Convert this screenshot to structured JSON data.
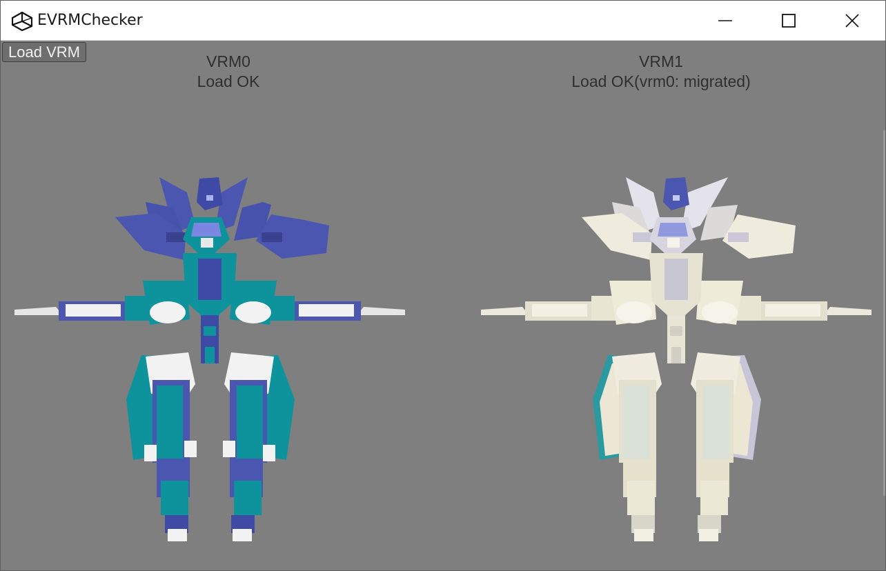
{
  "window": {
    "title": "EVRMChecker",
    "icon": "unity-logo-icon",
    "controls": [
      "minimize-icon",
      "maximize-icon",
      "close-icon"
    ]
  },
  "toolbar": {
    "load_button_label": "Load VRM"
  },
  "panels": [
    {
      "title": "VRM0",
      "status": "Load OK"
    },
    {
      "title": "VRM1",
      "status": "Load OK(vrm0: migrated)"
    }
  ],
  "colors": {
    "viewport_background": "#7f7f7f",
    "vrm0_primary": "#4a56b0",
    "vrm0_secondary": "#0e929c",
    "vrm0_trim": "#f2f2f2",
    "vrm1_primary": "#ece7d2",
    "vrm1_accent": "#2a9aa0"
  }
}
